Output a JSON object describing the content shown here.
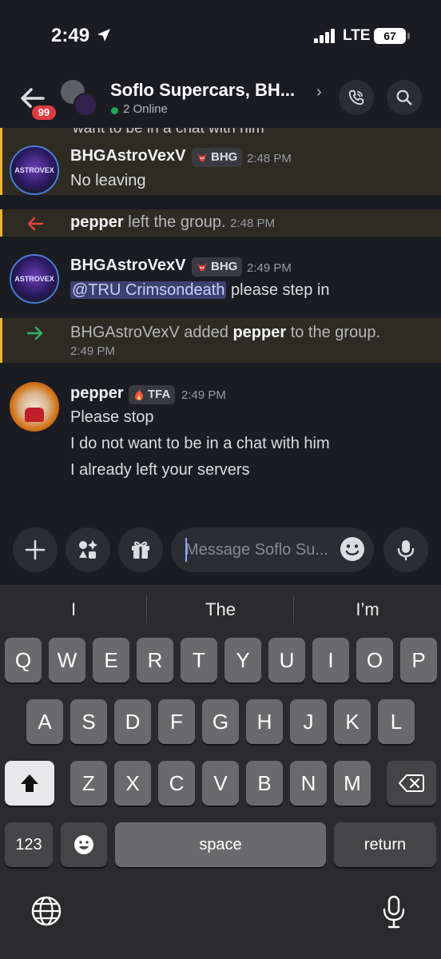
{
  "status_bar": {
    "time": "2:49",
    "network": "LTE",
    "battery": "67"
  },
  "header": {
    "unread_badge": "99",
    "title": "Soflo Supercars, BH...",
    "online": "2 Online"
  },
  "messages": {
    "cut_text": "want to be in a chat with him",
    "m1": {
      "author": "BHGAstroVexV",
      "tag": "BHG",
      "time": "2:48 PM",
      "text": "No leaving",
      "avatar_text": "ASTROVEX"
    },
    "sys1": {
      "user": "pepper",
      "text": " left the group. ",
      "time": "2:48 PM"
    },
    "m2": {
      "author": "BHGAstroVexV",
      "tag": "BHG",
      "time": "2:49 PM",
      "mention": "@TRU Crimsondeath",
      "text": " please step in"
    },
    "sys2": {
      "user1": "BHGAstroVexV",
      "mid": " added ",
      "user2": "pepper",
      "end": " to the group.",
      "time": "2:49 PM"
    },
    "m3": {
      "author": "pepper",
      "tag": "TFA",
      "time": "2:49 PM",
      "lines": [
        "Please stop",
        "I do not want to be in a chat with him",
        "I already left your servers"
      ]
    }
  },
  "composer": {
    "placeholder": "Message Soflo Su..."
  },
  "keyboard": {
    "suggestions": [
      "I",
      "The",
      "I’m"
    ],
    "row1": [
      "Q",
      "W",
      "E",
      "R",
      "T",
      "Y",
      "U",
      "I",
      "O",
      "P"
    ],
    "row2": [
      "A",
      "S",
      "D",
      "F",
      "G",
      "H",
      "J",
      "K",
      "L"
    ],
    "row3": [
      "Z",
      "X",
      "C",
      "V",
      "B",
      "N",
      "M"
    ],
    "numbers": "123",
    "space": "space",
    "return": "return"
  },
  "colors": {
    "online": "#23a55a",
    "badge": "#e13b42",
    "highlight_bar": "#f0b232",
    "mention_bg": "#3c4270",
    "leave_arrow": "#e3443f",
    "join_arrow": "#2fb365"
  }
}
